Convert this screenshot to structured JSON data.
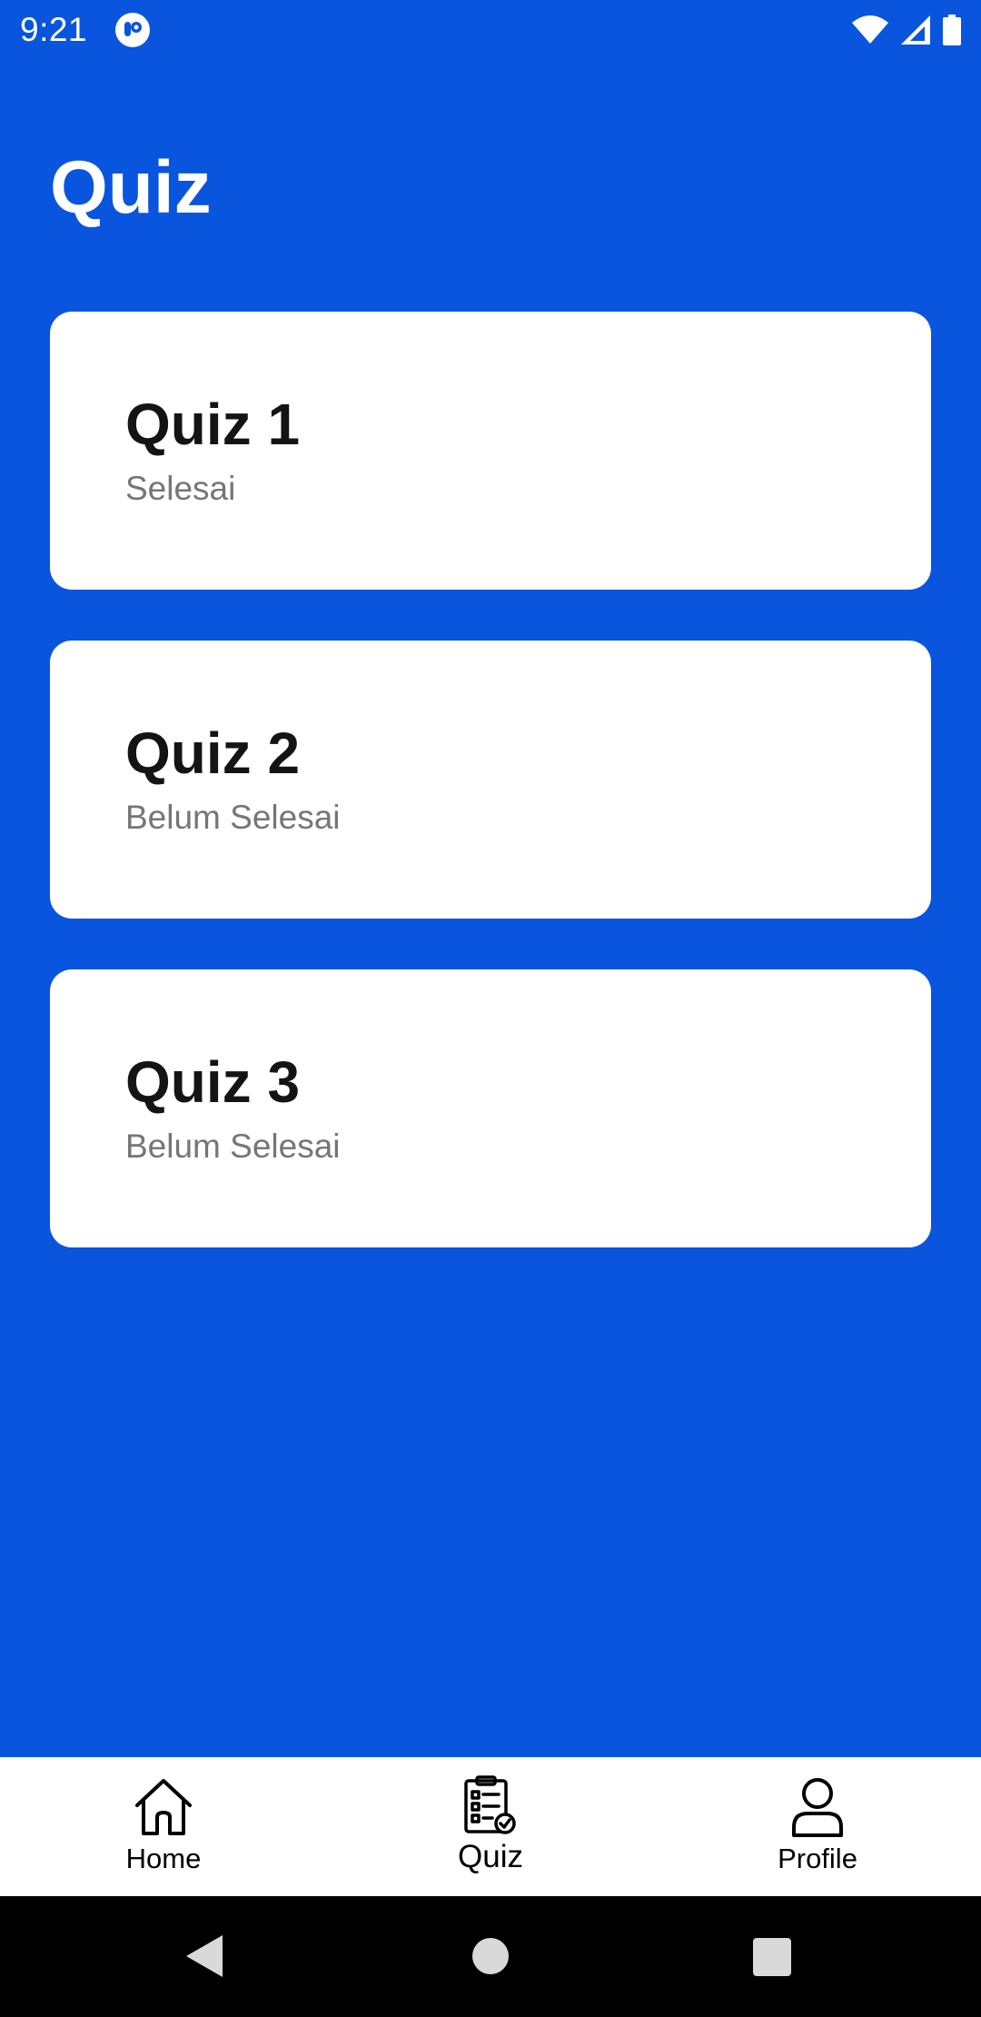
{
  "status_bar": {
    "time": "9:21",
    "icons": [
      "app-notification-icon",
      "wifi-icon",
      "signal-icon",
      "battery-icon"
    ]
  },
  "page": {
    "title": "Quiz"
  },
  "quizzes": [
    {
      "title": "Quiz 1",
      "status": "Selesai"
    },
    {
      "title": "Quiz 2",
      "status": "Belum Selesai"
    },
    {
      "title": "Quiz 3",
      "status": "Belum Selesai"
    }
  ],
  "bottom_nav": {
    "items": [
      {
        "label": "Home",
        "icon": "home-icon",
        "active": false
      },
      {
        "label": "Quiz",
        "icon": "clipboard-check-icon",
        "active": true
      },
      {
        "label": "Profile",
        "icon": "person-icon",
        "active": false
      }
    ]
  },
  "system_nav": {
    "buttons": [
      "back-icon",
      "home-circle-icon",
      "recents-icon"
    ]
  },
  "colors": {
    "background": "#0a55de",
    "card": "#ffffff",
    "title_text": "#141414",
    "status_text": "#767676"
  }
}
